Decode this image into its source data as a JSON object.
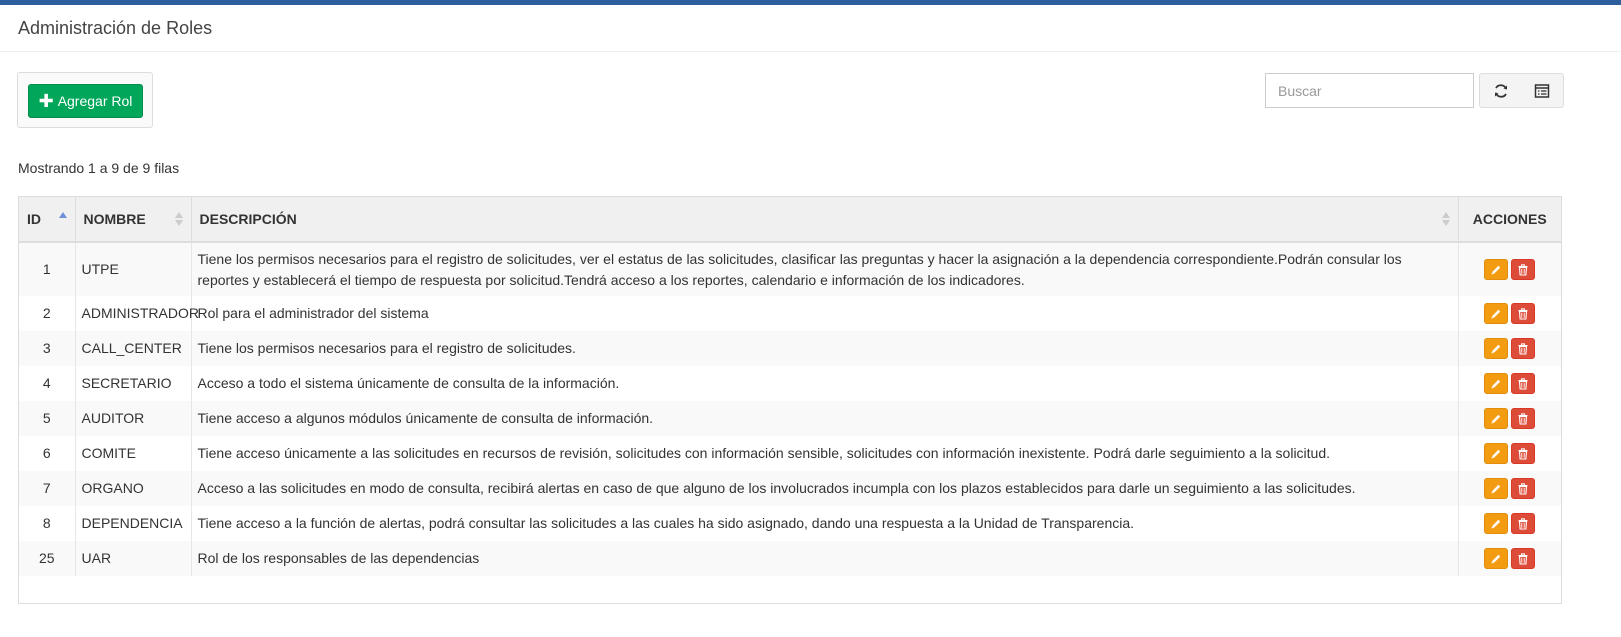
{
  "page": {
    "title": "Administración de Roles"
  },
  "toolbar": {
    "add_label": "Agregar Rol"
  },
  "search": {
    "placeholder": "Buscar"
  },
  "pagination": {
    "info": "Mostrando 1 a 9 de 9 filas"
  },
  "table": {
    "headers": {
      "id": "ID",
      "name": "NOMBRE",
      "description": "DESCRIPCIÓN",
      "actions": "ACCIONES"
    },
    "rows": [
      {
        "id": "1",
        "name": "UTPE",
        "description": "Tiene los permisos necesarios para el registro de solicitudes, ver el estatus de las solicitudes, clasificar las preguntas y hacer la asignación a la dependencia correspondiente.Podrán consular los reportes y establecerá el tiempo de respuesta por solicitud.Tendrá acceso a los reportes, calendario e información de los indicadores."
      },
      {
        "id": "2",
        "name": "ADMINISTRADOR",
        "description": "Rol para el administrador del sistema"
      },
      {
        "id": "3",
        "name": "CALL_CENTER",
        "description": "Tiene los permisos necesarios para el registro de solicitudes."
      },
      {
        "id": "4",
        "name": "SECRETARIO",
        "description": "Acceso a todo el sistema únicamente de consulta de la información."
      },
      {
        "id": "5",
        "name": "AUDITOR",
        "description": "Tiene acceso a algunos módulos únicamente de consulta de información."
      },
      {
        "id": "6",
        "name": "COMITE",
        "description": "Tiene acceso únicamente a las solicitudes en recursos de revisión, solicitudes con información sensible, solicitudes con información inexistente. Podrá darle seguimiento a la solicitud."
      },
      {
        "id": "7",
        "name": "ORGANO",
        "description": "Acceso a las solicitudes en modo de consulta, recibirá alertas en caso de que alguno de los involucrados incumpla con los plazos establecidos para darle un seguimiento a las solicitudes."
      },
      {
        "id": "8",
        "name": "DEPENDENCIA",
        "description": "Tiene acceso a la función de alertas, podrá consultar las solicitudes a las cuales ha sido asignado, dando una respuesta a la Unidad de Transparencia."
      },
      {
        "id": "25",
        "name": "UAR",
        "description": "Rol de los responsables de las dependencias"
      }
    ]
  },
  "colors": {
    "accent_bar": "#2c5f9b",
    "add_button": "#00a65a",
    "edit_button": "#f39c12",
    "delete_button": "#dd4b39"
  },
  "icons": {
    "add": "plus-icon",
    "refresh": "refresh-icon",
    "columns": "columns-list-icon",
    "edit": "pencil-icon",
    "delete": "trash-icon"
  }
}
